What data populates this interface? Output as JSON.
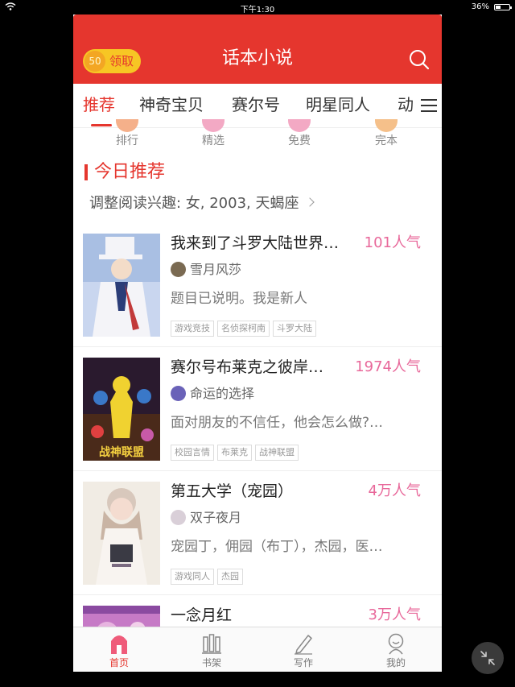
{
  "status_bar": {
    "time": "下午1:30",
    "battery_text": "36%",
    "battery_level": 0.36
  },
  "header": {
    "coins": "50",
    "claim_label": "领取",
    "title": "话本小说",
    "colors": {
      "brand": "#e5362e",
      "coin": "#f7c624"
    }
  },
  "tabs": [
    {
      "label": "推荐",
      "active": true
    },
    {
      "label": "神奇宝贝"
    },
    {
      "label": "赛尔号"
    },
    {
      "label": "明星同人"
    },
    {
      "label": "动"
    }
  ],
  "shortcuts": [
    {
      "label": "排行",
      "color": "#f5b08a"
    },
    {
      "label": "精选",
      "color": "#f3a9c4"
    },
    {
      "label": "免费",
      "color": "#f3a9c4"
    },
    {
      "label": "完本",
      "color": "#f5c08a"
    }
  ],
  "section": {
    "title": "今日推荐",
    "interest_text": "调整阅读兴趣: 女, 2003, 天蝎座"
  },
  "books": [
    {
      "title": "我来到了斗罗大陆世界…",
      "popularity": "101人气",
      "author": "雪月风莎",
      "description": "题目已说明。我是新人",
      "tags": [
        "游戏竞技",
        "名侦探柯南",
        "斗罗大陆"
      ]
    },
    {
      "title": "赛尔号布莱克之彼岸…",
      "popularity": "1974人气",
      "author": "命运的选择",
      "description": "面对朋友的不信任，他会怎么做?…",
      "tags": [
        "校园言情",
        "布莱克",
        "战神联盟"
      ],
      "cover_text": "战神联盟"
    },
    {
      "title": "第五大学（宠园）",
      "popularity": "4万人气",
      "author": "双子夜月",
      "description": "宠园丁，佣园（布丁），杰园，医…",
      "tags": [
        "游戏同人",
        "杰园"
      ]
    },
    {
      "title": "一念月红",
      "popularity": "3万人气"
    }
  ],
  "bottom_nav": [
    {
      "label": "首页",
      "active": true
    },
    {
      "label": "书架"
    },
    {
      "label": "写作"
    },
    {
      "label": "我的"
    }
  ]
}
